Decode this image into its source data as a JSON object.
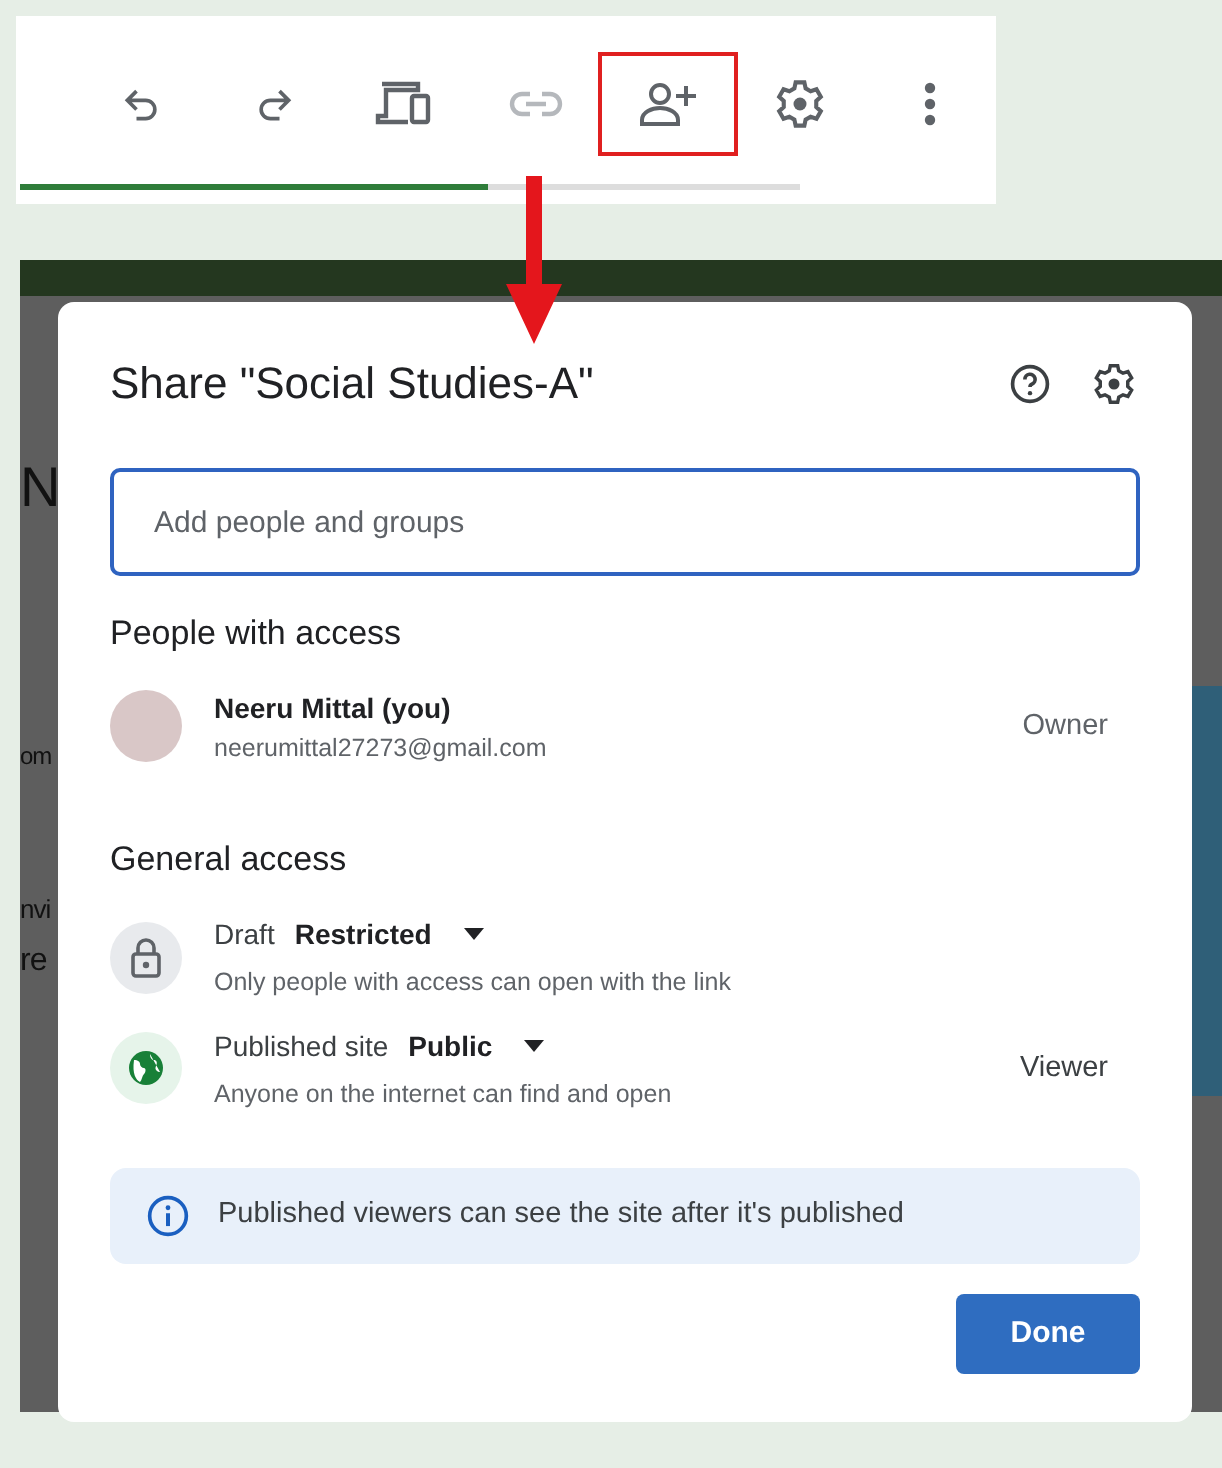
{
  "toolbar": {
    "buttons": [
      {
        "kind": "undo",
        "disabled": false,
        "highlighted": false
      },
      {
        "kind": "redo",
        "disabled": false,
        "highlighted": false
      },
      {
        "kind": "devices",
        "disabled": false,
        "highlighted": false
      },
      {
        "kind": "link",
        "disabled": true,
        "highlighted": false
      },
      {
        "kind": "share",
        "disabled": false,
        "highlighted": true
      },
      {
        "kind": "settings",
        "disabled": false,
        "highlighted": false
      },
      {
        "kind": "more",
        "disabled": false,
        "highlighted": false
      }
    ],
    "progress": {
      "level": 0.6
    }
  },
  "background_fragments": [
    "N",
    "om",
    "nvi",
    "re"
  ],
  "dialog": {
    "title": "Share \"Social Studies-A\"",
    "input": {
      "placeholder": "Add people and groups"
    },
    "people_heading": "People with access",
    "people": [
      {
        "name": "Neeru Mittal (you)",
        "email": "neerumittal27273@gmail.com",
        "role": "Owner"
      }
    ],
    "general_heading": "General access",
    "access": [
      {
        "kind": "lock",
        "label": "Draft",
        "value": "Restricted",
        "description": "Only people with access can open with the link"
      },
      {
        "kind": "globe",
        "label": "Published site",
        "value": "Public",
        "description": "Anyone on the internet can find and open",
        "role": "Viewer"
      }
    ],
    "note": "Published viewers can see the site after it's published",
    "done": "Done"
  }
}
